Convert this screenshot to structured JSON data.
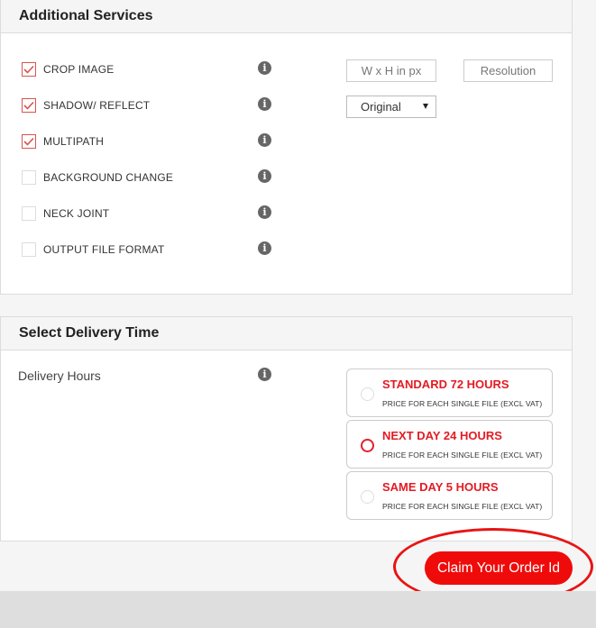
{
  "services": {
    "title": "Additional Services",
    "items": [
      {
        "label": "CROP IMAGE",
        "checked": true
      },
      {
        "label": "SHADOW/ REFLECT",
        "checked": true
      },
      {
        "label": "MULTIPATH",
        "checked": true
      },
      {
        "label": "BACKGROUND CHANGE",
        "checked": false
      },
      {
        "label": "NECK JOINT",
        "checked": false
      },
      {
        "label": "OUTPUT FILE FORMAT",
        "checked": false
      }
    ],
    "info_glyph": "i",
    "size_input": {
      "placeholder": "W x H in px",
      "value": ""
    },
    "resolution_input": {
      "placeholder": "Resolution",
      "value": ""
    },
    "shadow_select": {
      "selected": "Original"
    }
  },
  "delivery": {
    "title": "Select Delivery Time",
    "label": "Delivery Hours",
    "options": [
      {
        "title": "STANDARD 72 HOURS",
        "subtitle": "PRICE FOR EACH SINGLE FILE (EXCL VAT)",
        "selected": false
      },
      {
        "title": "NEXT DAY 24 HOURS",
        "subtitle": "PRICE FOR EACH SINGLE FILE (EXCL VAT)",
        "selected": true
      },
      {
        "title": "SAME DAY 5 HOURS",
        "subtitle": "PRICE FOR EACH SINGLE FILE (EXCL VAT)",
        "selected": false
      }
    ]
  },
  "claim_button": {
    "label": "Claim Your Order Id"
  },
  "colors": {
    "accent": "#e31b23",
    "button": "#f00b0b",
    "annotation": "#e81414"
  },
  "icons": {
    "info": "info-icon",
    "check": "check-icon",
    "caret": "caret-down-icon"
  }
}
